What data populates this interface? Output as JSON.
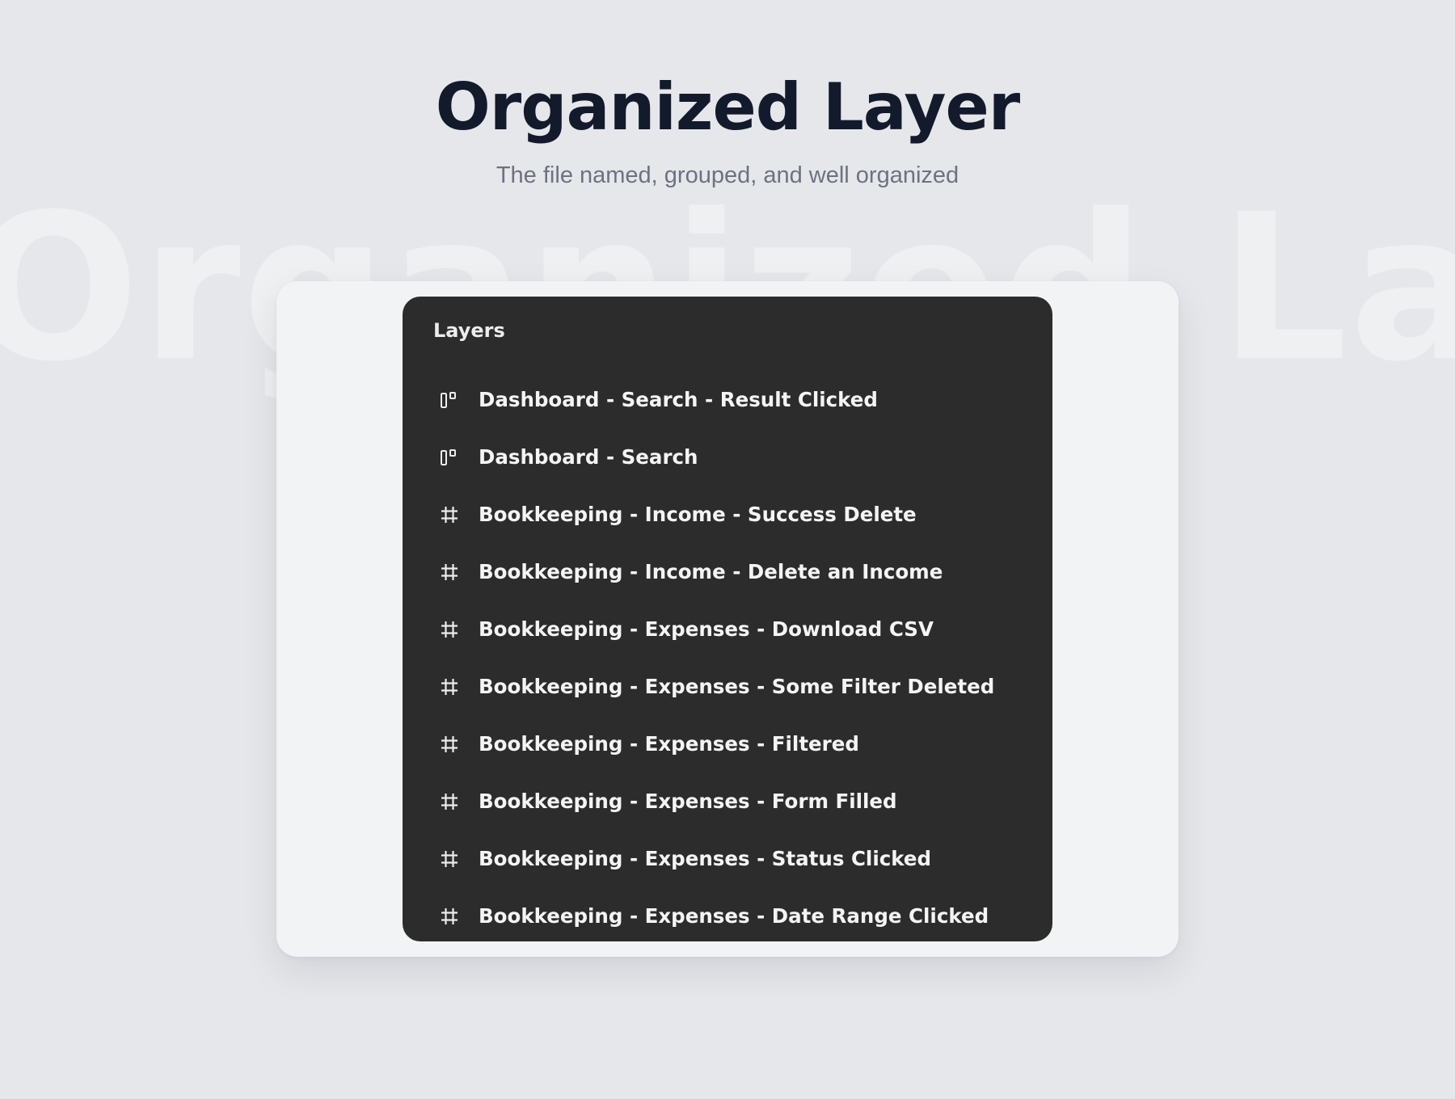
{
  "hero": {
    "title": "Organized Layer",
    "subtitle": "The file named, grouped, and well organized",
    "watermark": "Organized Layer"
  },
  "layers_panel": {
    "heading": "Layers",
    "items": [
      {
        "label": "Dashboard - Search - Result Clicked",
        "icon": "component-icon"
      },
      {
        "label": "Dashboard - Search",
        "icon": "component-icon"
      },
      {
        "label": "Bookkeeping - Income - Success Delete",
        "icon": "frame-icon"
      },
      {
        "label": "Bookkeeping - Income - Delete an Income",
        "icon": "frame-icon"
      },
      {
        "label": "Bookkeeping - Expenses - Download CSV",
        "icon": "frame-icon"
      },
      {
        "label": "Bookkeeping - Expenses - Some Filter Deleted",
        "icon": "frame-icon"
      },
      {
        "label": "Bookkeeping - Expenses - Filtered",
        "icon": "frame-icon"
      },
      {
        "label": "Bookkeeping - Expenses - Form Filled",
        "icon": "frame-icon"
      },
      {
        "label": "Bookkeeping - Expenses - Status Clicked",
        "icon": "frame-icon"
      },
      {
        "label": "Bookkeeping - Expenses - Date Range Clicked",
        "icon": "frame-icon"
      }
    ]
  },
  "colors": {
    "page_background": "#e6e7eb",
    "card_background": "#f2f3f5",
    "panel_background": "#2c2c2c",
    "title_color": "#131a2b",
    "subtitle_color": "#6c7280",
    "layer_text_color": "#f4f4f4"
  }
}
